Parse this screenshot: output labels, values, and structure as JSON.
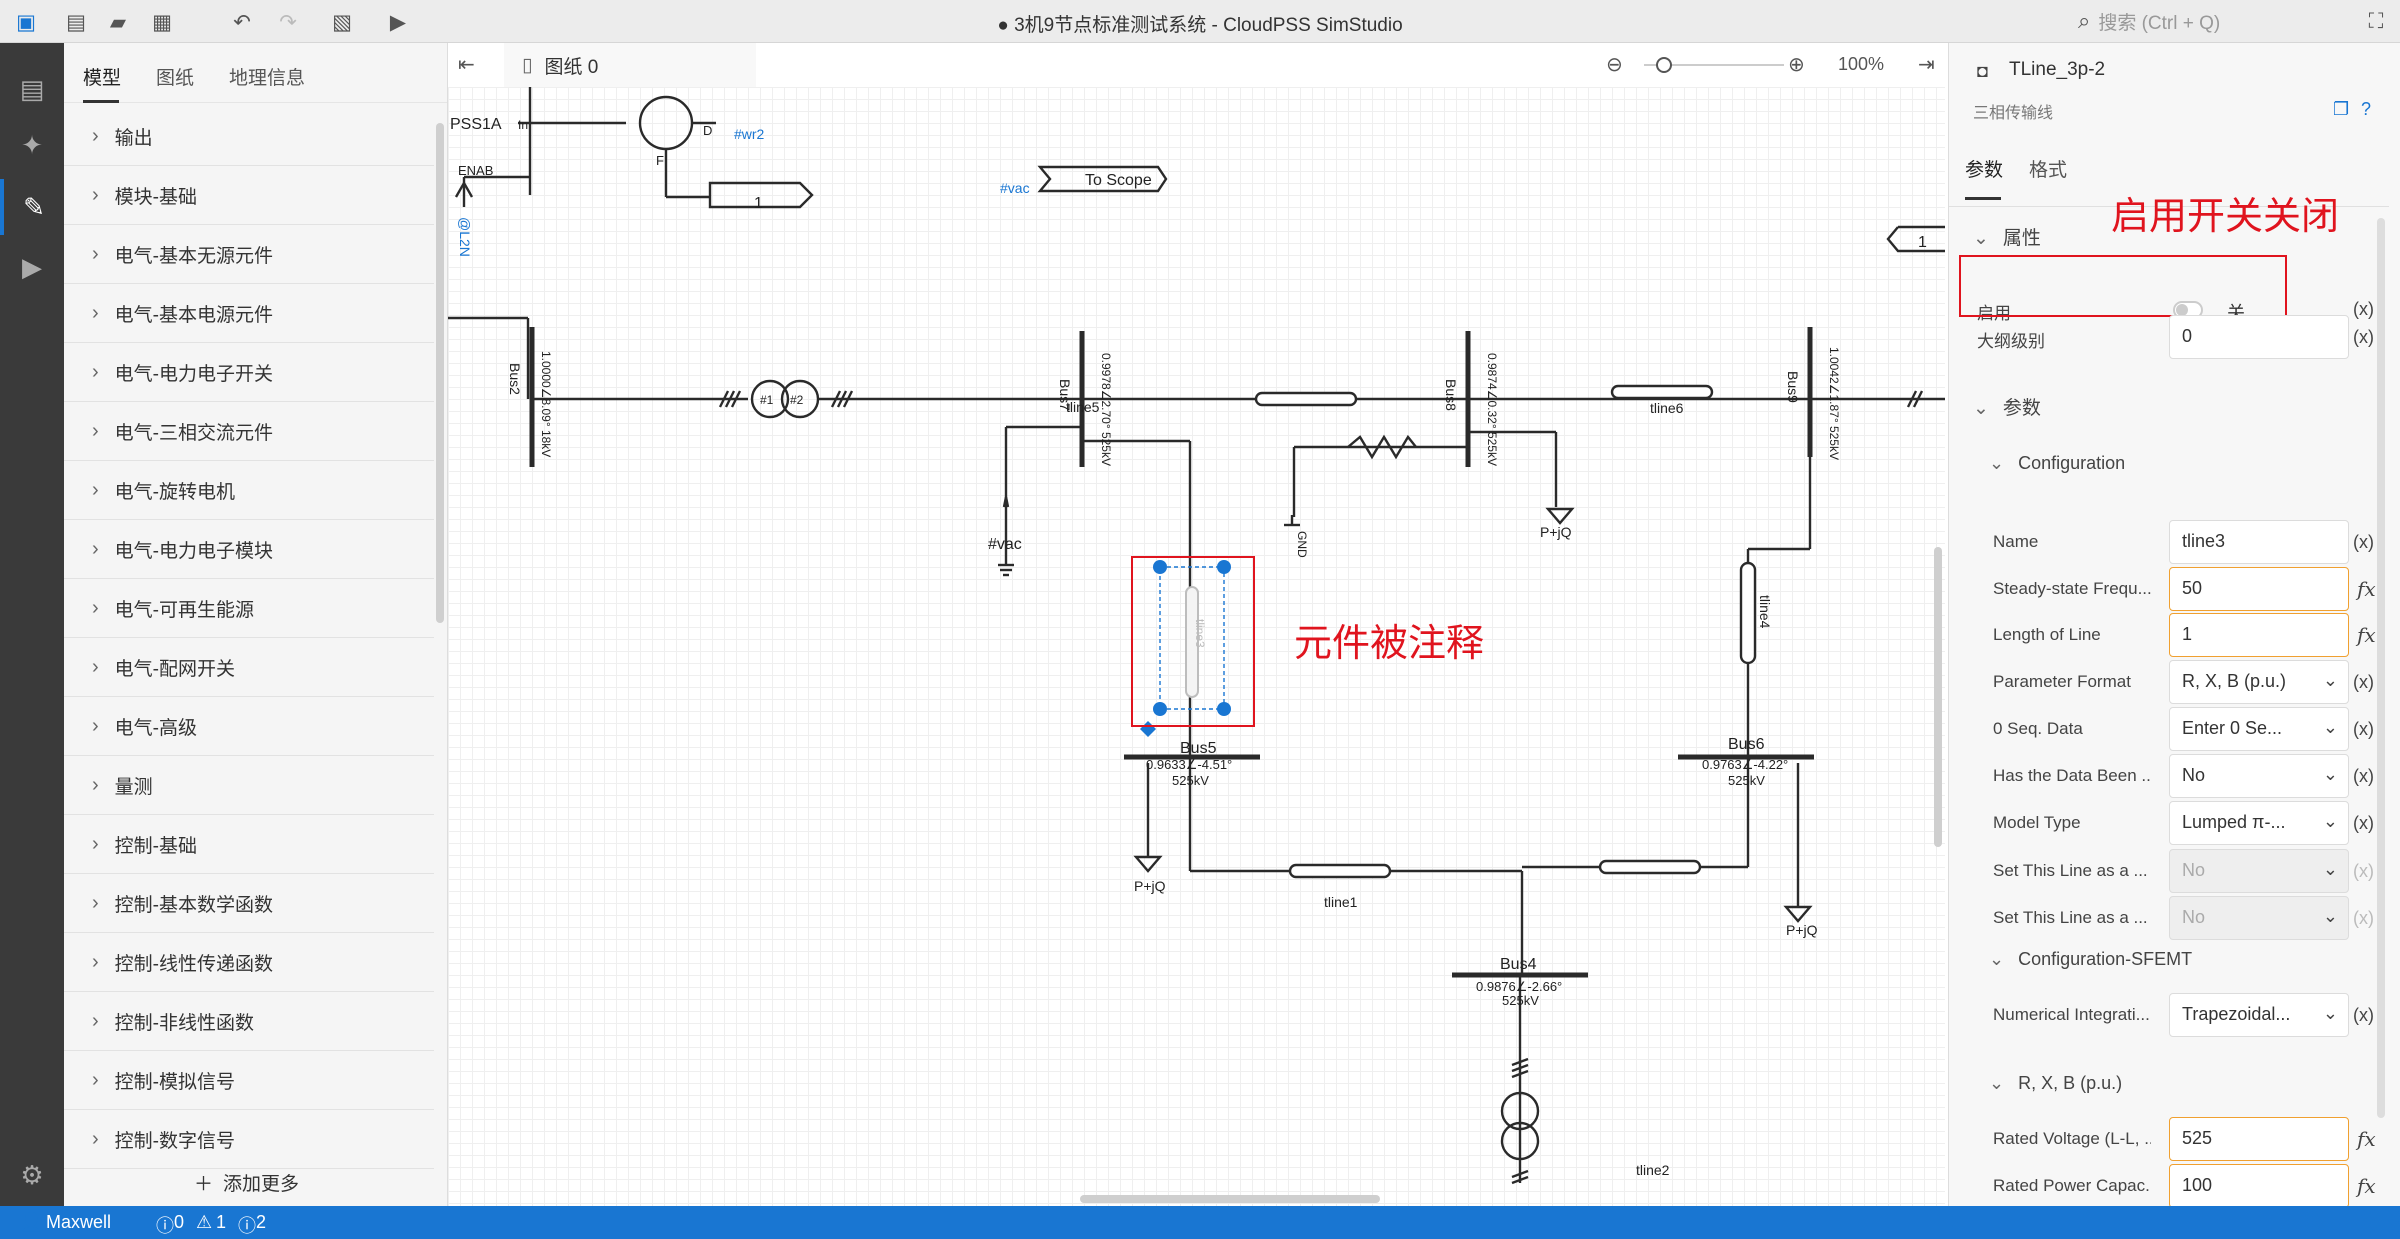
{
  "window": {
    "title": "● 3机9节点标准测试系统 - CloudPSS SimStudio",
    "search_placeholder": "搜索 (Ctrl + Q)"
  },
  "left_panel": {
    "tabs": [
      "模型",
      "图纸",
      "地理信息"
    ],
    "items": [
      "输出",
      "模块-基础",
      "电气-基本无源元件",
      "电气-基本电源元件",
      "电气-电力电子开关",
      "电气-三相交流元件",
      "电气-旋转电机",
      "电气-电力电子模块",
      "电气-可再生能源",
      "电气-配网开关",
      "电气-高级",
      "量测",
      "控制-基础",
      "控制-基本数学函数",
      "控制-线性传递函数",
      "控制-非线性函数",
      "控制-模拟信号",
      "控制-数字信号"
    ],
    "add_more": "添加更多"
  },
  "doc": {
    "tab_label": "图纸 0",
    "zoom": "100%"
  },
  "canvas_labels": {
    "pss": "PSS1A",
    "in": "In",
    "enab": "ENAB",
    "at_l2n": "@L2N",
    "wr2": "#wr2",
    "d": "D",
    "f": "F",
    "const1": "1",
    "const2": "1",
    "vac_tag": "#vac",
    "to_scope": "To Scope",
    "bus2": "Bus2",
    "bus2_val": "1.0000∠8.09° 18kV",
    "bus7": "Bus7",
    "bus7_val": "0.9978∠2.70° 525kV",
    "bus8": "Bus8",
    "bus8_val": "0.9874∠0.32° 525kV",
    "bus9": "Bus9",
    "bus9_val": "1.0042∠1.87° 525kV",
    "bus5": "Bus5",
    "bus5_val1": "0.9633∠-4.51°",
    "bus5_val2": "525kV",
    "bus6": "Bus6",
    "bus6_val1": "0.9763∠-4.22°",
    "bus6_val2": "525kV",
    "bus4": "Bus4",
    "bus4_val1": "0.9876∠-2.66°",
    "bus4_val2": "525kV",
    "tline1": "tline1",
    "tline2": "tline2",
    "tline3": "tline3",
    "tline4": "tline4",
    "tline5": "tline5",
    "tline6": "tline6",
    "pq": "P+jQ",
    "gnd": "GND",
    "vac": "#vac",
    "t1": "#1",
    "t2": "#2"
  },
  "annotations": {
    "commented": "元件被注释",
    "switch_off": "启用开关关闭"
  },
  "right_panel": {
    "component": "TLine_3p-2",
    "subtitle": "三相传输线",
    "tabs": [
      "参数",
      "格式"
    ],
    "sec_props": "属性",
    "enable_label": "启用",
    "enable_state": "关",
    "outline_label": "大纲级别",
    "outline_value": "0",
    "sec_params": "参数",
    "sec_config": "Configuration",
    "rows": [
      {
        "label": "Name",
        "value": "tline3"
      },
      {
        "label": "Steady-state Frequ...",
        "value": "50"
      },
      {
        "label": "Length of Line",
        "value": "1"
      },
      {
        "label": "Parameter Format",
        "value": "R, X, B (p.u.)"
      },
      {
        "label": "0 Seq. Data",
        "value": "Enter 0 Se..."
      },
      {
        "label": "Has the Data Been ...",
        "value": "No"
      },
      {
        "label": "Model Type",
        "value": "Lumped π-..."
      },
      {
        "label": "Set This Line as a ...",
        "value": "No"
      },
      {
        "label": "Set This Line as a ...",
        "value": "No"
      }
    ],
    "sec_sfemt": "Configuration-SFEMT",
    "num_label": "Numerical Integrati...",
    "num_value": "Trapezoidal...",
    "sec_rxb": "R, X, B (p.u.)",
    "rv_label": "Rated Voltage (L-L, ...",
    "rv_value": "525",
    "rp_label": "Rated Power Capac...",
    "rp_value": "100",
    "x_mark": "(x)"
  },
  "status": {
    "user": "Maxwell",
    "errors": "0",
    "warnings": "1",
    "infos": "2"
  }
}
